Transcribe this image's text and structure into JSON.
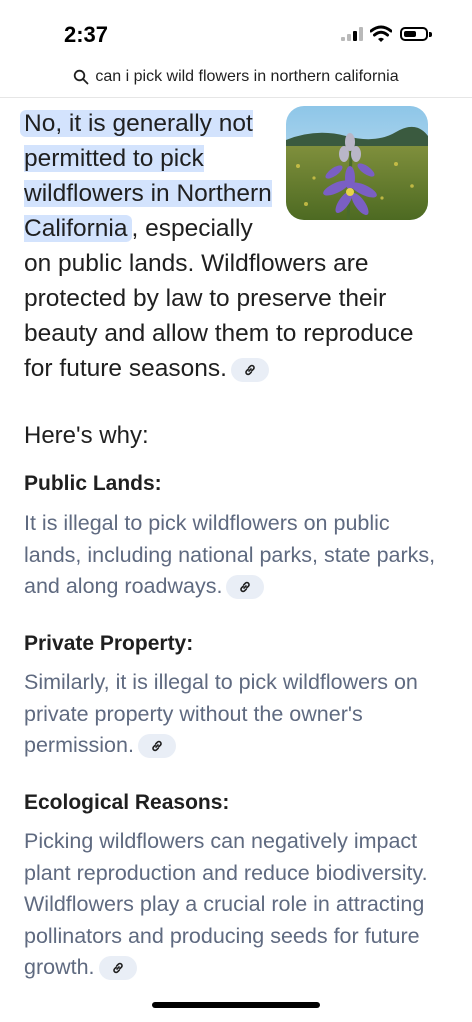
{
  "status_bar": {
    "time": "2:37"
  },
  "query": {
    "text": "can i pick wild flowers in northern california"
  },
  "answer": {
    "highlight": "No, it is generally not permitted to pick wildflowers in Northern California",
    "rest": ", especially on public lands. Wildflowers are protected by law to preserve their beauty and allow them to reproduce for future seasons.",
    "image_alt": "purple camas wildflower in a meadow"
  },
  "why_heading": "Here's why:",
  "sections": [
    {
      "title": "Public Lands:",
      "body": "It is illegal to pick wildflowers on public lands, including national parks, state parks, and along roadways."
    },
    {
      "title": "Private Property:",
      "body": "Similarly, it is illegal to pick wildflowers on private property without the owner's permission."
    },
    {
      "title": "Ecological Reasons:",
      "body": "Picking wildflowers can negatively impact plant reproduction and reduce biodiversity. Wildflowers play a crucial role in attracting pollinators and producing seeds for future growth."
    }
  ]
}
